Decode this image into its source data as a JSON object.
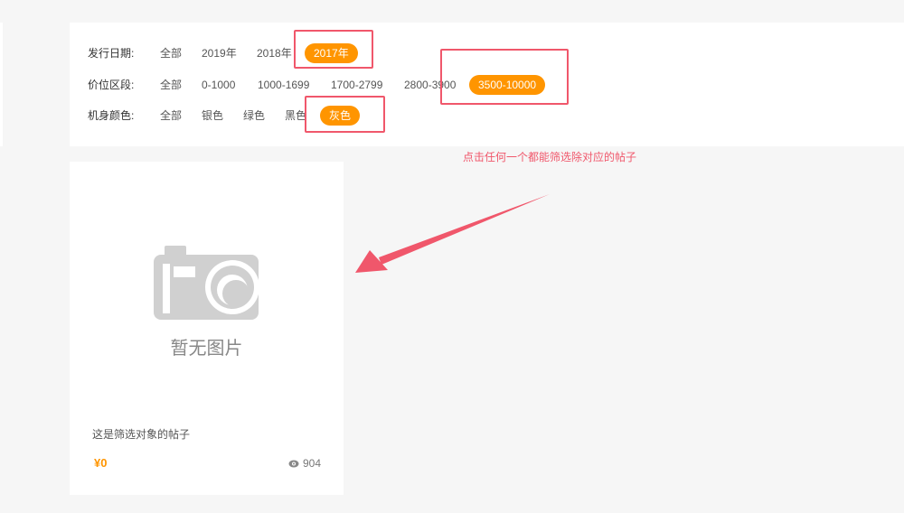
{
  "filters": {
    "release_date": {
      "label": "发行日期:",
      "options": [
        "全部",
        "2019年",
        "2018年",
        "2017年"
      ],
      "active": "2017年"
    },
    "price_range": {
      "label": "价位区段:",
      "options": [
        "全部",
        "0-1000",
        "1000-1699",
        "1700-2799",
        "2800-3900",
        "3500-10000"
      ],
      "active": "3500-10000"
    },
    "body_color": {
      "label": "机身颜色:",
      "options": [
        "全部",
        "银色",
        "绿色",
        "黑色",
        "灰色"
      ],
      "active": "灰色"
    }
  },
  "annotation": "点击任何一个都能筛选除对应的帖子",
  "card": {
    "image_placeholder": "暂无图片",
    "title": "这是筛选对象的帖子",
    "price": "¥0",
    "views": "904"
  },
  "colors": {
    "accent": "#ff9500",
    "annotation": "#f0576b",
    "placeholder_icon": "#d0d0d0"
  },
  "icons": {
    "camera": "camera-icon",
    "views": "eye-icon"
  }
}
